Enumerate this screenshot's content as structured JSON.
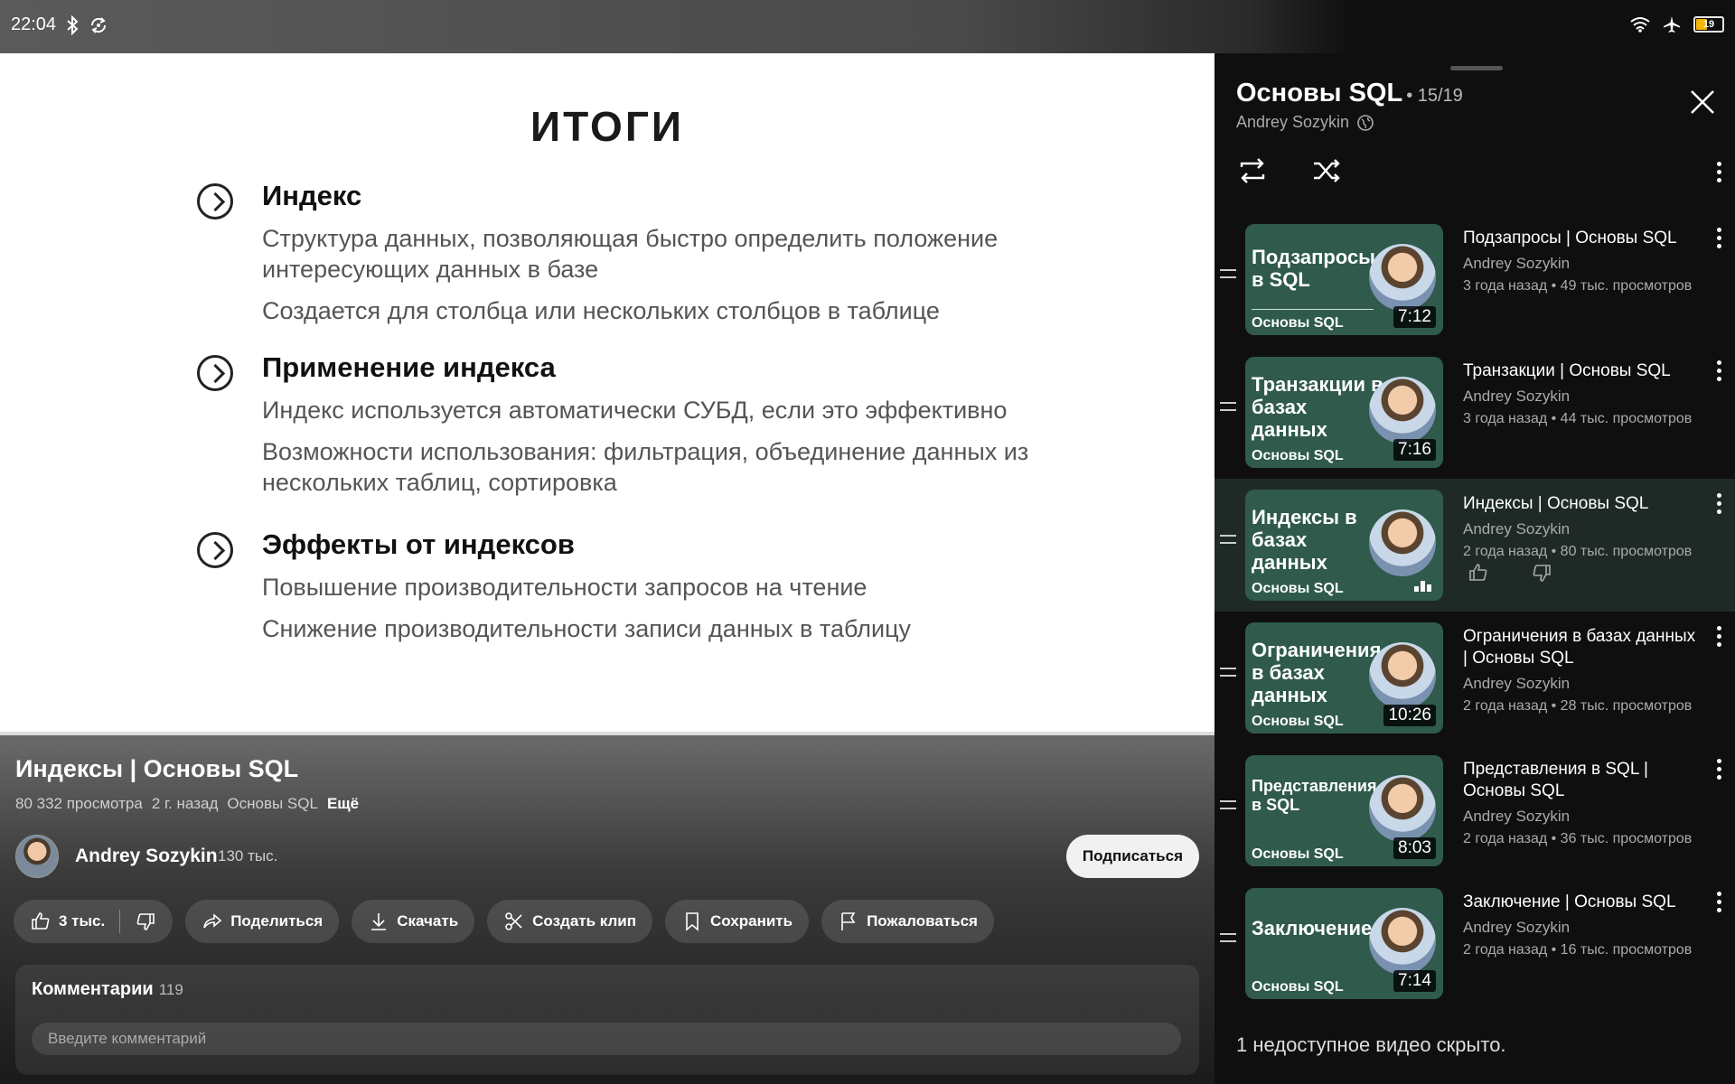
{
  "status_bar": {
    "time": "22:04",
    "battery": "19"
  },
  "slide": {
    "title": "ИТОГИ",
    "points": [
      {
        "heading": "Индекс",
        "lines": [
          "Структура данных, позволяющая быстро определить положение интересующих данных в базе",
          "Создается для столбца или нескольких столбцов в таблице"
        ]
      },
      {
        "heading": "Применение индекса",
        "lines": [
          "Индекс используется автоматически СУБД, если это эффективно",
          "Возможности использования: фильтрация, объединение данных из нескольких таблиц, сортировка"
        ]
      },
      {
        "heading": "Эффекты от индексов",
        "lines": [
          "Повышение производительности запросов на чтение",
          "Снижение производительности записи данных в таблицу"
        ]
      }
    ]
  },
  "video": {
    "title": "Индексы | Основы SQL",
    "views": "80 332 просмотра",
    "age": "2 г. назад",
    "playlist_tag": "Основы SQL",
    "more": "Ещё",
    "channel": "Andrey Sozykin",
    "subscribers": "130 тыс.",
    "subscribe_label": "Подписаться",
    "likes": "3 тыс.",
    "share": "Поделиться",
    "download": "Скачать",
    "clip": "Создать клип",
    "save": "Сохранить",
    "report": "Пожаловаться",
    "comments_label": "Комментарии",
    "comments_count": "119",
    "comment_placeholder": "Введите комментарий"
  },
  "playlist": {
    "title": "Основы SQL",
    "position": "• 15/19",
    "author": "Andrey Sozykin",
    "items": [
      {
        "thumb_text": "Подзапросы в SQL",
        "thumb_sub": "Основы SQL",
        "duration": "7:12",
        "title": "Подзапросы | Основы SQL",
        "author": "Andrey Sozykin",
        "stats": "3 года назад • 49 тыс. просмотров"
      },
      {
        "thumb_text": "Транзакции в базах данных",
        "thumb_sub": "Основы SQL",
        "duration": "7:16",
        "title": "Транзакции | Основы SQL",
        "author": "Andrey Sozykin",
        "stats": "3 года назад • 44 тыс. просмотров"
      },
      {
        "thumb_text": "Индексы в базах данных",
        "thumb_sub": "Основы SQL",
        "duration": "",
        "title": "Индексы | Основы SQL",
        "author": "Andrey Sozykin",
        "stats": "2 года назад • 80 тыс. просмотров",
        "active": true
      },
      {
        "thumb_text": "Ограничения в базах данных",
        "thumb_sub": "Основы SQL",
        "duration": "10:26",
        "title": "Ограничения в базах данных | Основы SQL",
        "author": "Andrey Sozykin",
        "stats": "2 года назад • 28 тыс. просмотров"
      },
      {
        "thumb_text": "Представления в SQL",
        "thumb_sub": "Основы SQL",
        "duration": "8:03",
        "title": "Представления в SQL | Основы SQL",
        "author": "Andrey Sozykin",
        "stats": "2 года назад • 36 тыс. просмотров"
      },
      {
        "thumb_text": "Заключение",
        "thumb_sub": "Основы SQL",
        "duration": "7:14",
        "title": "Заключение | Основы SQL",
        "author": "Andrey Sozykin",
        "stats": "2 года назад • 16 тыс. просмотров"
      }
    ],
    "hidden_note": "1 недоступное видео скрыто."
  },
  "colors": {
    "thumb_bg": "#2f5a4c",
    "active_row": "#1f2a26",
    "battery_fill": "#f4b400"
  }
}
